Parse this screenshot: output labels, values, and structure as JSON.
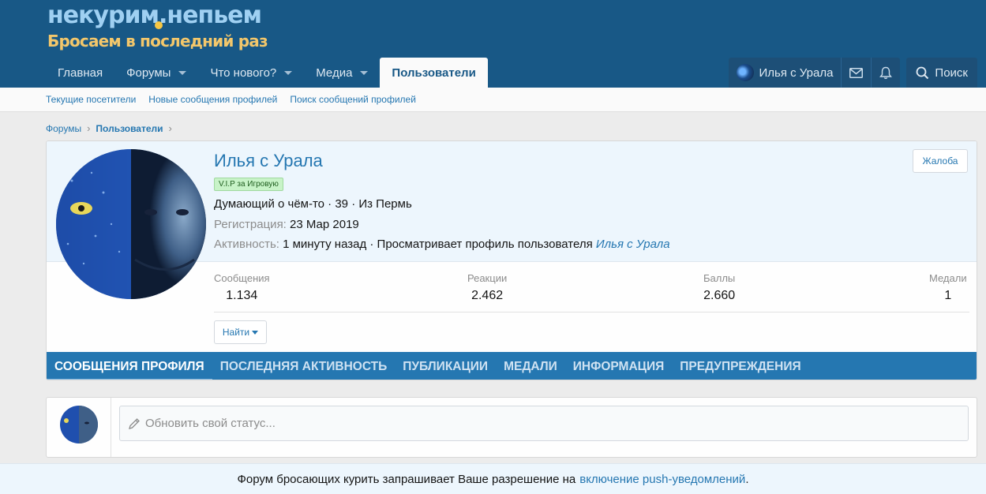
{
  "logo": {
    "line1": "некурим.непьем",
    "line2": "Бросаем в последний раз"
  },
  "nav": {
    "items": [
      {
        "label": "Главная"
      },
      {
        "label": "Форумы"
      },
      {
        "label": "Что нового?"
      },
      {
        "label": "Медиа"
      },
      {
        "label": "Пользователи"
      }
    ],
    "user_label": "Илья с Урала",
    "search_label": "Поиск"
  },
  "subnav": [
    "Текущие посетители",
    "Новые сообщения профилей",
    "Поиск сообщений профилей"
  ],
  "breadcrumb": [
    "Форумы",
    "Пользователи"
  ],
  "profile": {
    "name": "Илья с Урала",
    "badge": "V.I.P за Игровую",
    "title_line": "Думающий о чём-то · 39 · Из Пермь",
    "registration_label": "Регистрация:",
    "registration_value": "23 Мар 2019",
    "activity_label": "Активность:",
    "activity_value": "1 минуту назад · Просматривает профиль пользователя",
    "activity_link": "Илья с Урала",
    "report_label": "Жалоба",
    "find_label": "Найти",
    "stats": [
      {
        "label": "Сообщения",
        "value": "1.134"
      },
      {
        "label": "Реакции",
        "value": "2.462"
      },
      {
        "label": "Баллы",
        "value": "2.660"
      },
      {
        "label": "Медали",
        "value": "1"
      }
    ]
  },
  "tabs": [
    "СООБЩЕНИЯ ПРОФИЛЯ",
    "ПОСЛЕДНЯЯ АКТИВНОСТЬ",
    "ПУБЛИКАЦИИ",
    "МЕДАЛИ",
    "ИНФОРМАЦИЯ",
    "ПРЕДУПРЕЖДЕНИЯ"
  ],
  "status": {
    "placeholder": "Обновить свой статус..."
  },
  "push": {
    "text": "Форум бросающих курить запрашивает Ваше разрешение на",
    "link": "включение push-уведомлений",
    "end": "."
  },
  "colors": {
    "header": "#185886",
    "accent": "#2577b1",
    "tabbar": "#2577b1"
  },
  "icons": [
    "mail-icon",
    "bell-icon",
    "search-icon",
    "pencil-icon",
    "chevron-right-icon",
    "caret-down-icon"
  ]
}
